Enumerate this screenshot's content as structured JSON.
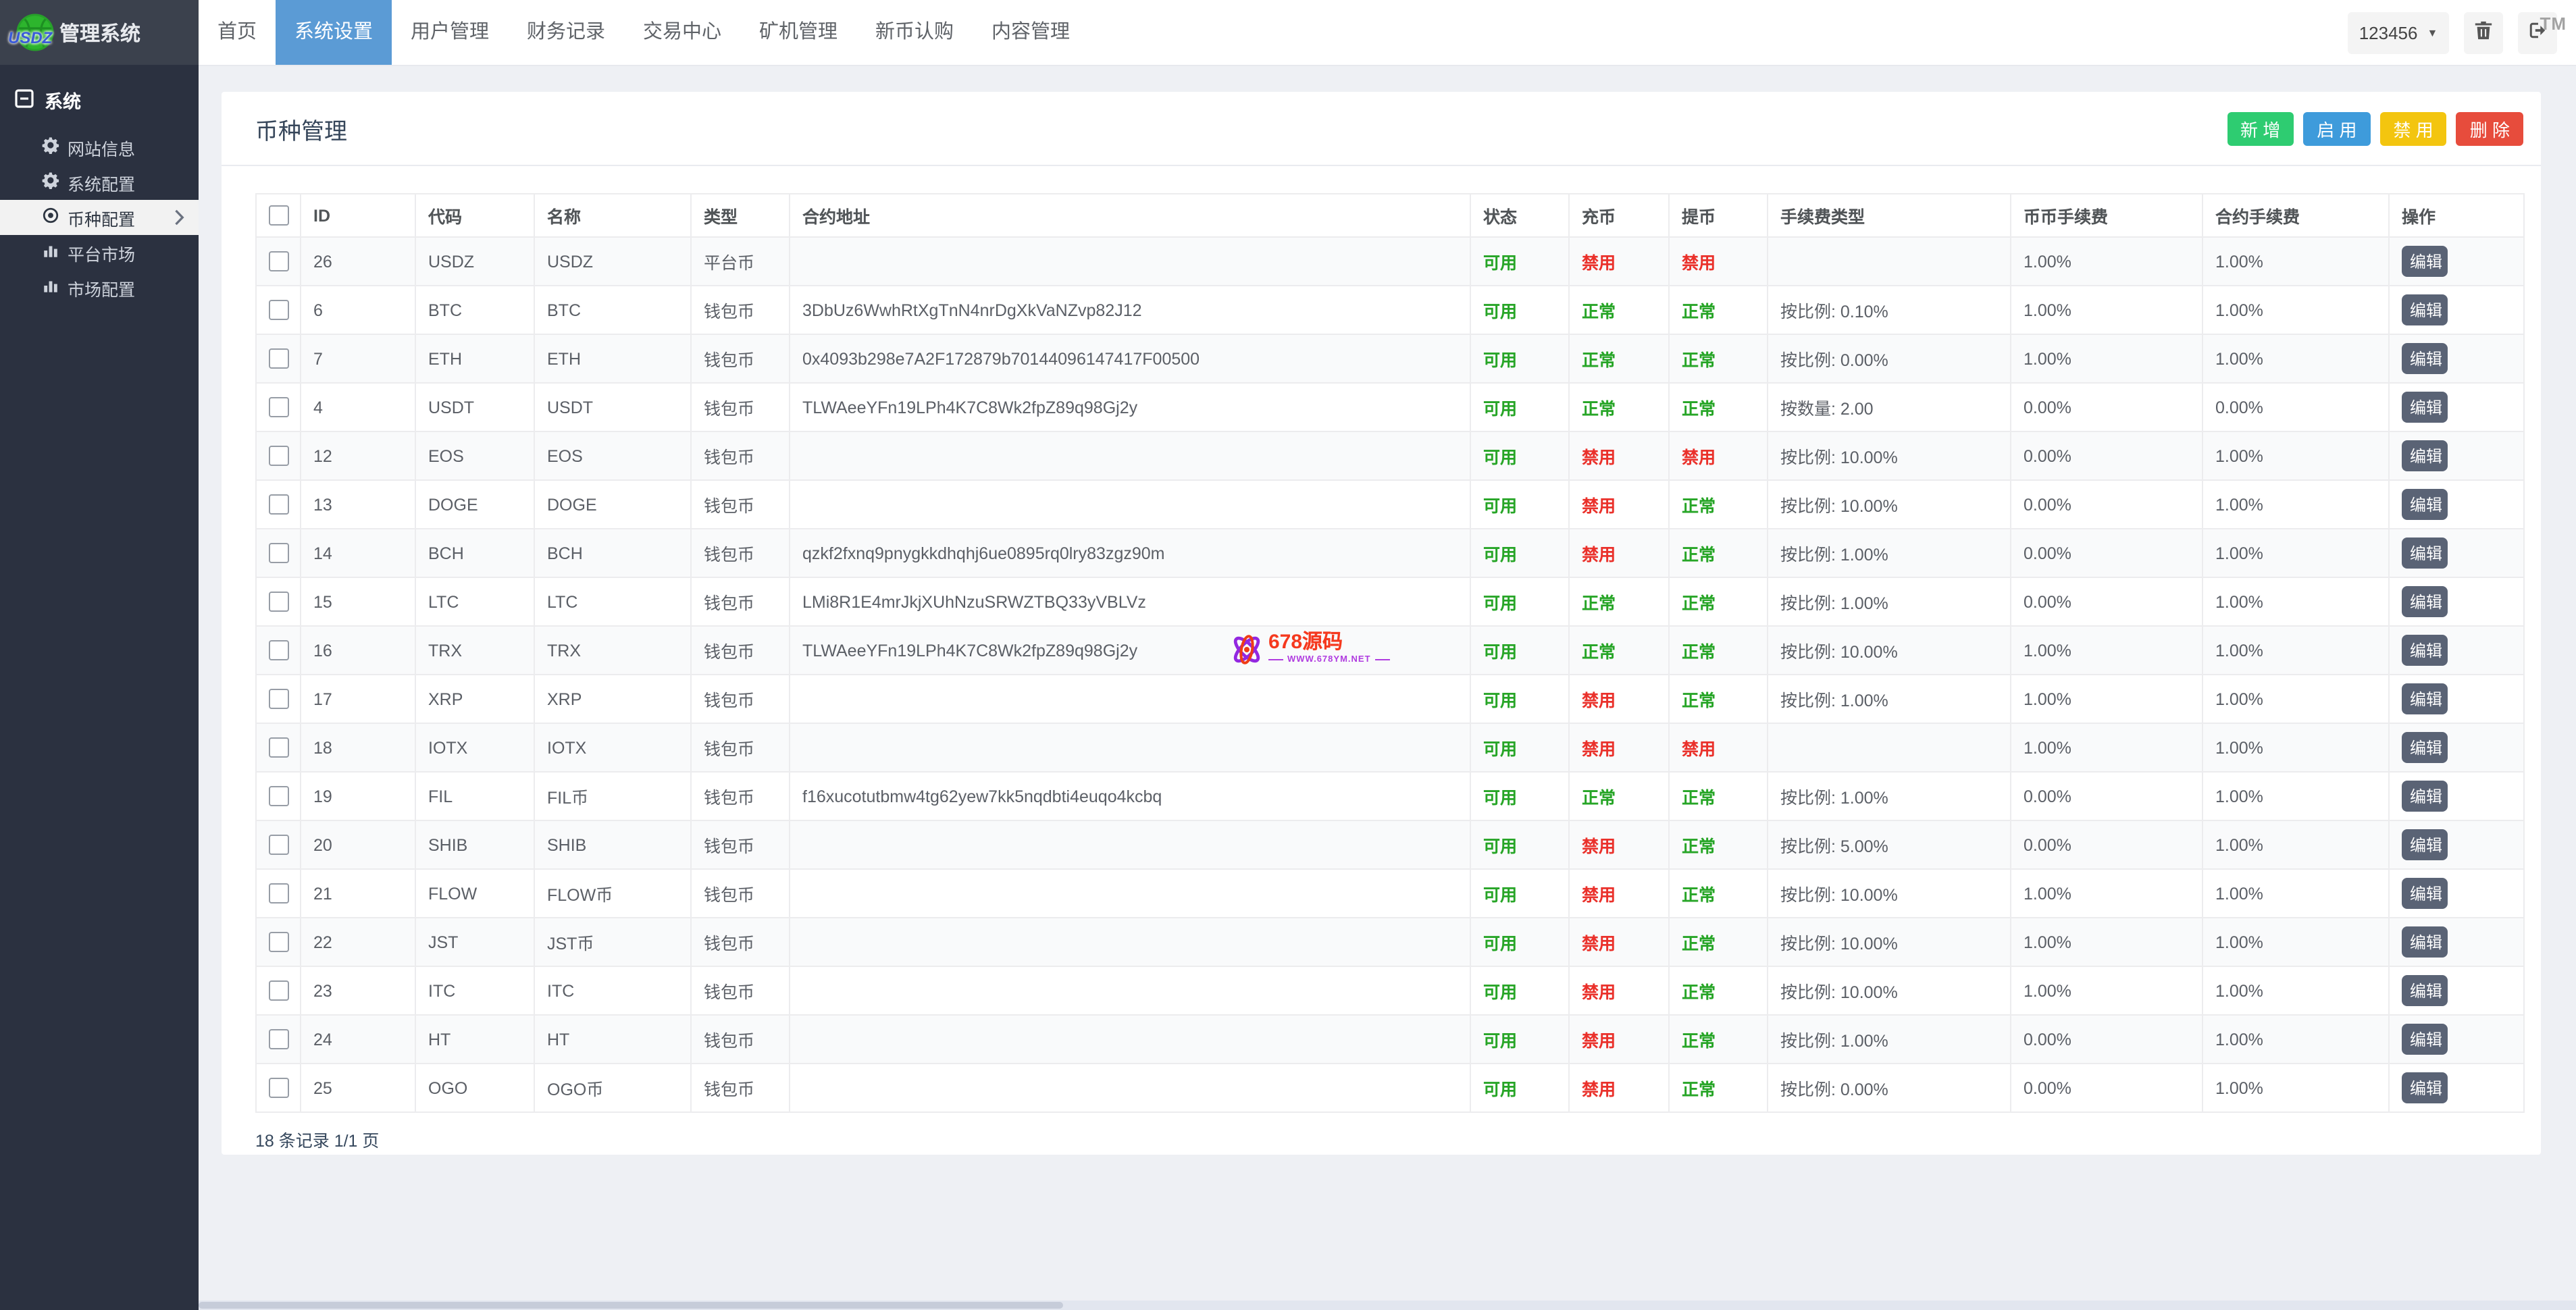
{
  "app": {
    "logo_text": "USDZ",
    "brand": "管理系统",
    "user_label": "123456",
    "tm_mark": "TM"
  },
  "navbar": {
    "tabs": [
      {
        "key": "home",
        "label": "首页",
        "active": false
      },
      {
        "key": "system-settings",
        "label": "系统设置",
        "active": true
      },
      {
        "key": "user-management",
        "label": "用户管理",
        "active": false
      },
      {
        "key": "finance-records",
        "label": "财务记录",
        "active": false
      },
      {
        "key": "trade-center",
        "label": "交易中心",
        "active": false
      },
      {
        "key": "miner-management",
        "label": "矿机管理",
        "active": false
      },
      {
        "key": "new-coin-subscribe",
        "label": "新币认购",
        "active": false
      },
      {
        "key": "content-management",
        "label": "内容管理",
        "active": false
      }
    ]
  },
  "sidebar": {
    "section": "系统",
    "items": [
      {
        "key": "site-info",
        "label": "网站信息",
        "icon": "gear-icon",
        "active": false
      },
      {
        "key": "system-config",
        "label": "系统配置",
        "icon": "gear-icon",
        "active": false
      },
      {
        "key": "coin-config",
        "label": "币种配置",
        "icon": "target-icon",
        "active": true
      },
      {
        "key": "platform-market",
        "label": "平台市场",
        "icon": "chart-icon",
        "active": false
      },
      {
        "key": "market-config",
        "label": "市场配置",
        "icon": "chart-icon",
        "active": false
      }
    ]
  },
  "page": {
    "title": "币种管理",
    "actions": [
      {
        "key": "add",
        "label": "新 增",
        "style": "green"
      },
      {
        "key": "enable",
        "label": "启 用",
        "style": "blue"
      },
      {
        "key": "disable",
        "label": "禁 用",
        "style": "yellow"
      },
      {
        "key": "delete",
        "label": "删 除",
        "style": "red"
      }
    ],
    "footer": "18 条记录 1/1 页"
  },
  "table": {
    "headers": [
      "ID",
      "代码",
      "名称",
      "类型",
      "合约地址",
      "状态",
      "充币",
      "提币",
      "手续费类型",
      "币币手续费",
      "合约手续费",
      "操作"
    ],
    "edit_label": "编辑",
    "rows": [
      {
        "id": "26",
        "code": "USDZ",
        "name": "USDZ",
        "type": "平台币",
        "contract": "",
        "status": "可用",
        "deposit": "禁用",
        "withdraw": "禁用",
        "fee_type": "",
        "coin_fee": "1.00%",
        "contract_fee": "1.00%"
      },
      {
        "id": "6",
        "code": "BTC",
        "name": "BTC",
        "type": "钱包币",
        "contract": "3DbUz6WwhRtXgTnN4nrDgXkVaNZvp82J12",
        "status": "可用",
        "deposit": "正常",
        "withdraw": "正常",
        "fee_type": "按比例: 0.10%",
        "coin_fee": "1.00%",
        "contract_fee": "1.00%"
      },
      {
        "id": "7",
        "code": "ETH",
        "name": "ETH",
        "type": "钱包币",
        "contract": "0x4093b298e7A2F172879b70144096147417F00500",
        "status": "可用",
        "deposit": "正常",
        "withdraw": "正常",
        "fee_type": "按比例: 0.00%",
        "coin_fee": "1.00%",
        "contract_fee": "1.00%"
      },
      {
        "id": "4",
        "code": "USDT",
        "name": "USDT",
        "type": "钱包币",
        "contract": "TLWAeeYFn19LPh4K7C8Wk2fpZ89q98Gj2y",
        "status": "可用",
        "deposit": "正常",
        "withdraw": "正常",
        "fee_type": "按数量: 2.00",
        "coin_fee": "0.00%",
        "contract_fee": "0.00%"
      },
      {
        "id": "12",
        "code": "EOS",
        "name": "EOS",
        "type": "钱包币",
        "contract": "",
        "status": "可用",
        "deposit": "禁用",
        "withdraw": "禁用",
        "fee_type": "按比例: 10.00%",
        "coin_fee": "0.00%",
        "contract_fee": "1.00%"
      },
      {
        "id": "13",
        "code": "DOGE",
        "name": "DOGE",
        "type": "钱包币",
        "contract": "",
        "status": "可用",
        "deposit": "禁用",
        "withdraw": "正常",
        "fee_type": "按比例: 10.00%",
        "coin_fee": "0.00%",
        "contract_fee": "1.00%"
      },
      {
        "id": "14",
        "code": "BCH",
        "name": "BCH",
        "type": "钱包币",
        "contract": "qzkf2fxnq9pnygkkdhqhj6ue0895rq0lry83zgz90m",
        "status": "可用",
        "deposit": "禁用",
        "withdraw": "正常",
        "fee_type": "按比例: 1.00%",
        "coin_fee": "0.00%",
        "contract_fee": "1.00%"
      },
      {
        "id": "15",
        "code": "LTC",
        "name": "LTC",
        "type": "钱包币",
        "contract": "LMi8R1E4mrJkjXUhNzuSRWZTBQ33yVBLVz",
        "status": "可用",
        "deposit": "正常",
        "withdraw": "正常",
        "fee_type": "按比例: 1.00%",
        "coin_fee": "0.00%",
        "contract_fee": "1.00%"
      },
      {
        "id": "16",
        "code": "TRX",
        "name": "TRX",
        "type": "钱包币",
        "contract": "TLWAeeYFn19LPh4K7C8Wk2fpZ89q98Gj2y",
        "status": "可用",
        "deposit": "正常",
        "withdraw": "正常",
        "fee_type": "按比例: 10.00%",
        "coin_fee": "1.00%",
        "contract_fee": "1.00%"
      },
      {
        "id": "17",
        "code": "XRP",
        "name": "XRP",
        "type": "钱包币",
        "contract": "",
        "status": "可用",
        "deposit": "禁用",
        "withdraw": "正常",
        "fee_type": "按比例: 1.00%",
        "coin_fee": "1.00%",
        "contract_fee": "1.00%"
      },
      {
        "id": "18",
        "code": "IOTX",
        "name": "IOTX",
        "type": "钱包币",
        "contract": "",
        "status": "可用",
        "deposit": "禁用",
        "withdraw": "禁用",
        "fee_type": "",
        "coin_fee": "1.00%",
        "contract_fee": "1.00%"
      },
      {
        "id": "19",
        "code": "FIL",
        "name": "FIL币",
        "type": "钱包币",
        "contract": "f16xucotutbmw4tg62yew7kk5nqdbti4euqo4kcbq",
        "status": "可用",
        "deposit": "正常",
        "withdraw": "正常",
        "fee_type": "按比例: 1.00%",
        "coin_fee": "0.00%",
        "contract_fee": "1.00%"
      },
      {
        "id": "20",
        "code": "SHIB",
        "name": "SHIB",
        "type": "钱包币",
        "contract": "",
        "status": "可用",
        "deposit": "禁用",
        "withdraw": "正常",
        "fee_type": "按比例: 5.00%",
        "coin_fee": "0.00%",
        "contract_fee": "1.00%"
      },
      {
        "id": "21",
        "code": "FLOW",
        "name": "FLOW币",
        "type": "钱包币",
        "contract": "",
        "status": "可用",
        "deposit": "禁用",
        "withdraw": "正常",
        "fee_type": "按比例: 10.00%",
        "coin_fee": "1.00%",
        "contract_fee": "1.00%"
      },
      {
        "id": "22",
        "code": "JST",
        "name": "JST币",
        "type": "钱包币",
        "contract": "",
        "status": "可用",
        "deposit": "禁用",
        "withdraw": "正常",
        "fee_type": "按比例: 10.00%",
        "coin_fee": "1.00%",
        "contract_fee": "1.00%"
      },
      {
        "id": "23",
        "code": "ITC",
        "name": "ITC",
        "type": "钱包币",
        "contract": "",
        "status": "可用",
        "deposit": "禁用",
        "withdraw": "正常",
        "fee_type": "按比例: 10.00%",
        "coin_fee": "1.00%",
        "contract_fee": "1.00%"
      },
      {
        "id": "24",
        "code": "HT",
        "name": "HT",
        "type": "钱包币",
        "contract": "",
        "status": "可用",
        "deposit": "禁用",
        "withdraw": "正常",
        "fee_type": "按比例: 1.00%",
        "coin_fee": "0.00%",
        "contract_fee": "1.00%"
      },
      {
        "id": "25",
        "code": "OGO",
        "name": "OGO币",
        "type": "钱包币",
        "contract": "",
        "status": "可用",
        "deposit": "禁用",
        "withdraw": "正常",
        "fee_type": "按比例: 0.00%",
        "coin_fee": "0.00%",
        "contract_fee": "1.00%"
      }
    ]
  },
  "watermark": {
    "title": "678源码",
    "site": "WWW.678YM.NET"
  },
  "colors": {
    "accent_blue": "#5b9bd5",
    "sidebar_bg": "#2b3140",
    "brand_bg": "#3b414d",
    "green_text": "#27a527",
    "red_text": "#ea312b",
    "btn_green": "#2ecc71",
    "btn_blue": "#3e9bdb",
    "btn_yellow": "#f3c50f",
    "btn_red": "#e74c3c",
    "edit_btn": "#5a6375"
  }
}
